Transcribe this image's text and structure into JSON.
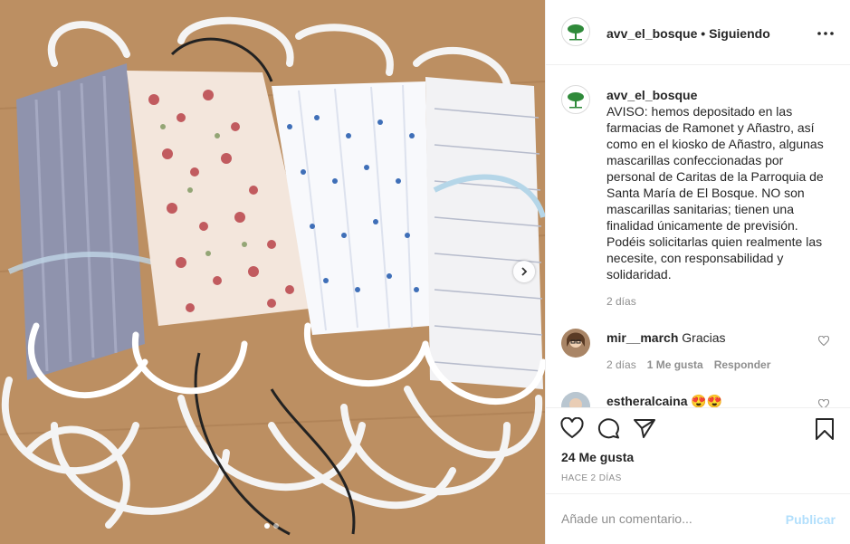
{
  "post": {
    "username": "avv_el_bosque",
    "separator": "•",
    "follow_label": "Siguiendo",
    "more_icon": "more-icon",
    "caption": "AVISO: hemos depositado en las farmacias de Ramonet y Añastro, así como en el kiosko de Añastro, algunas mascarillas confeccionadas por personal de Caritas de la Parroquia de Santa María de El Bosque. NO son mascarillas sanitarias; tienen una finalidad únicamente de previsión. Podéis solicitarlas quien realmente las necesite, con responsabilidad y solidaridad.",
    "caption_time": "2 días"
  },
  "comments": [
    {
      "username": "mir__march",
      "text": "Gracias",
      "time": "2 días",
      "likes": "1 Me gusta",
      "reply": "Responder"
    },
    {
      "username": "estheralcaina",
      "text": "😍😍"
    }
  ],
  "actions": {
    "likes": "24 Me gusta",
    "ago": "HACE 2 DÍAS"
  },
  "add_comment": {
    "placeholder": "Añade un comentario...",
    "publish": "Publicar"
  },
  "carousel": {
    "current": 1,
    "total": 2
  },
  "colors": {
    "accent_disabled": "#b2dffc",
    "muted": "#8e8e8e",
    "text": "#262626"
  }
}
